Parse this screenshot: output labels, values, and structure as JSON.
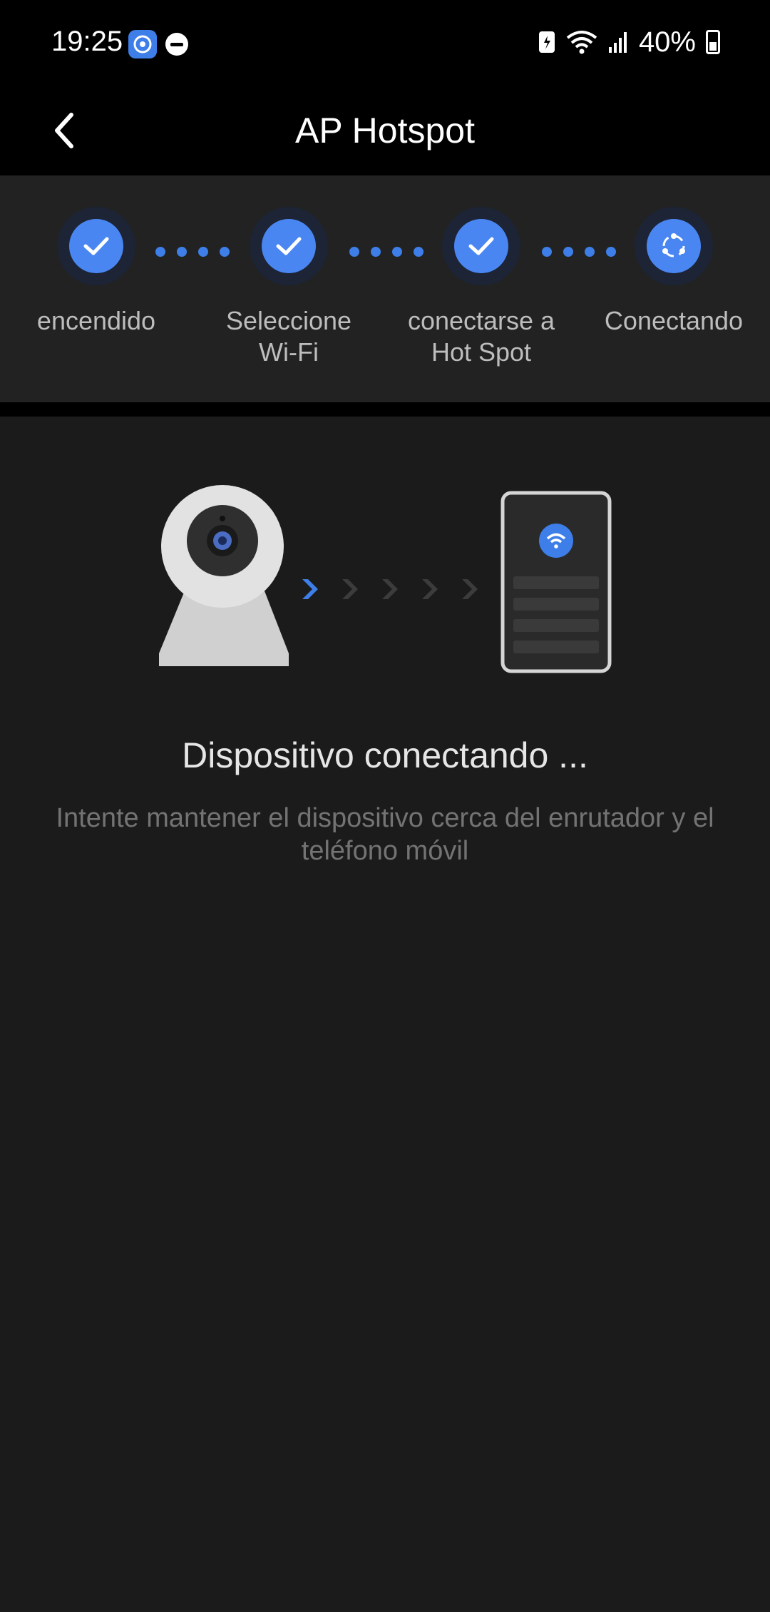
{
  "status_bar": {
    "time": "19:25",
    "battery_percent": "40%",
    "icons": [
      "app-notification-icon",
      "do-not-disturb-icon",
      "battery-saver-icon",
      "wifi-icon",
      "signal-icon",
      "battery-icon"
    ]
  },
  "header": {
    "title": "AP Hotspot",
    "back_icon": "chevron-left-icon"
  },
  "steps": [
    {
      "label_lines": [
        "encendido"
      ],
      "state": "done",
      "icon": "check-icon"
    },
    {
      "label_lines": [
        "Seleccione",
        "Wi-Fi"
      ],
      "state": "done",
      "icon": "check-icon"
    },
    {
      "label_lines": [
        "conectarse a",
        "Hot Spot"
      ],
      "state": "done",
      "icon": "check-icon"
    },
    {
      "label_lines": [
        "Conectando"
      ],
      "state": "active",
      "icon": "connecting-icon"
    }
  ],
  "main": {
    "title": "Dispositivo conectando ...",
    "description_line1": "Intente mantener el dispositivo cerca del enrutador y el",
    "description_line2": "teléfono móvil"
  },
  "colors": {
    "accent": "#4a86f2",
    "background": "#1b1b1b",
    "panel": "#222222"
  }
}
